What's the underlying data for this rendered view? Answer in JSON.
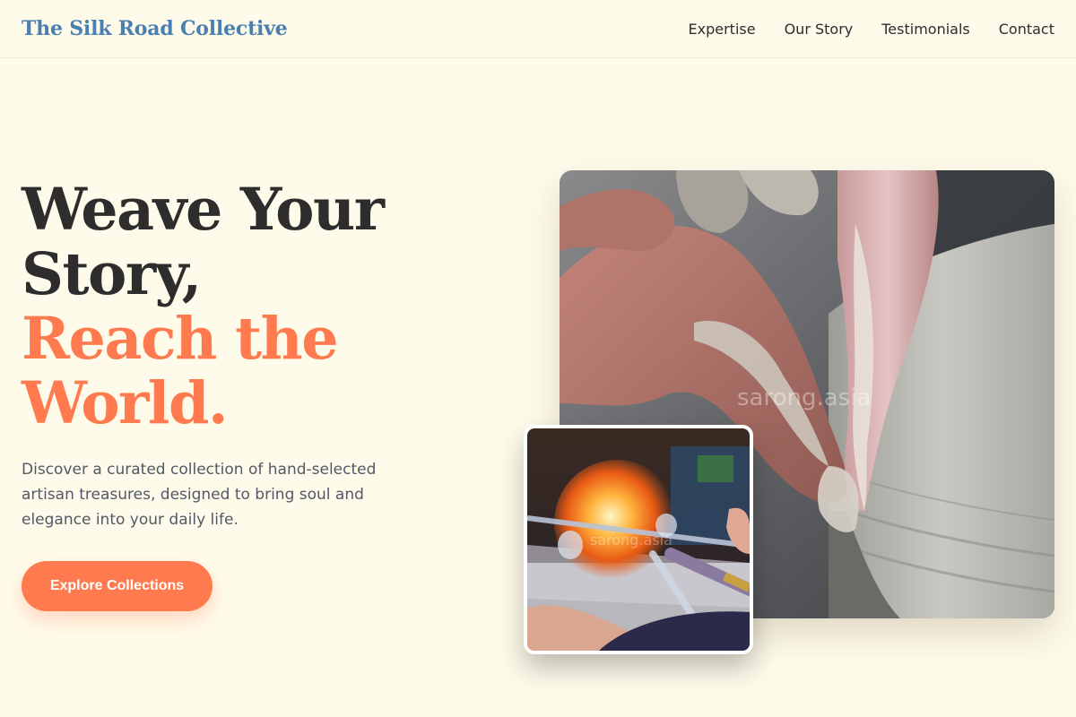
{
  "nav": {
    "brand": "The Silk Road Collective",
    "links": [
      "Expertise",
      "Our Story",
      "Testimonials",
      "Contact"
    ]
  },
  "hero": {
    "title_line1": "Weave Your",
    "title_line2": "Story,",
    "title_line3": "Reach the",
    "title_line4": "World.",
    "description": "Discover a curated collection of hand-selected artisan treasures, designed to bring soul and elegance into your daily life.",
    "cta_label": "Explore Collections"
  },
  "images": {
    "main_watermark": "sarong.asia",
    "small_watermark": "sarong.asia"
  },
  "colors": {
    "background": "#fffbeb",
    "brand": "#4a7fb0",
    "accent": "#ff7b4f",
    "text_dark": "#2d2d2d",
    "text_muted": "#525866"
  }
}
